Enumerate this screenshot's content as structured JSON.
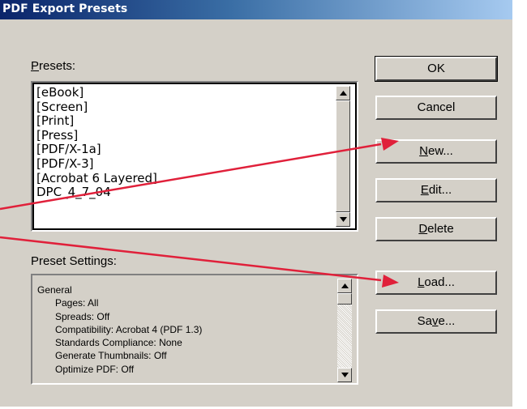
{
  "window": {
    "title": "PDF Export Presets"
  },
  "presets": {
    "label_accel": "P",
    "label_rest": "resets:",
    "items": [
      "[eBook]",
      "[Screen]",
      "[Print]",
      "[Press]",
      "[PDF/X-1a]",
      "[PDF/X-3]",
      "[Acrobat 6 Layered]",
      "DPC_4_7_04"
    ]
  },
  "preset_settings": {
    "label": "Preset Settings:",
    "category": "General",
    "lines": [
      "Pages: All",
      "Spreads: Off",
      "Compatibility: Acrobat 4 (PDF 1.3)",
      "Standards Compliance: None",
      "Generate Thumbnails: Off",
      "Optimize PDF: Off"
    ]
  },
  "buttons": {
    "ok": "OK",
    "cancel": "Cancel",
    "new_accel": "N",
    "new_rest": "ew...",
    "edit_accel": "E",
    "edit_rest": "dit...",
    "delete_accel": "D",
    "delete_rest": "elete",
    "load_accel": "L",
    "load_rest": "oad...",
    "save_pre": "Sa",
    "save_accel": "v",
    "save_rest": "e..."
  },
  "annotation_color": "#e0203a"
}
